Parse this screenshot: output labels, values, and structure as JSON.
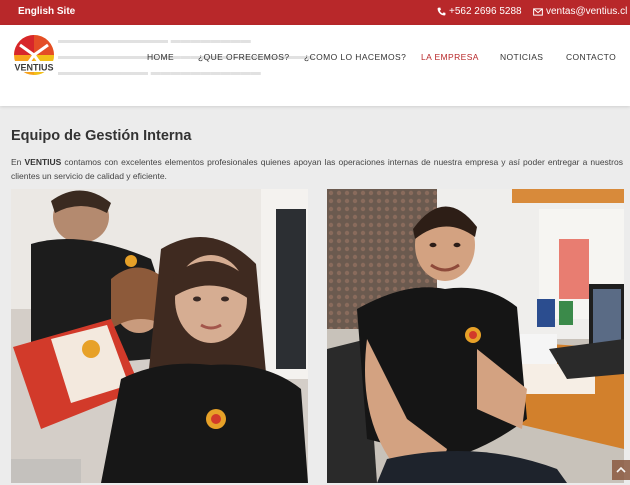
{
  "topbar": {
    "english_link": "English Site",
    "phone": "+562 2696 5288",
    "email": "ventas@ventius.cl",
    "background": "#b8282a"
  },
  "header": {
    "logo_text": "VENTIUS",
    "nav": [
      "HOME",
      "¿QUE OFRECEMOS?",
      "¿COMO LO HACEMOS?",
      "LA EMPRESA",
      "NOTICIAS",
      "CONTACTO"
    ],
    "active_nav": "LA EMPRESA",
    "accent": "#b8282a"
  },
  "main": {
    "title": "Equipo de Gestión Interna",
    "intro_brand": "VENTIUS",
    "intro_prefix": "En",
    "intro_text": "contamos con excelentes elementos profesionales quienes apoyan las operaciones internas de nuestra empresa y así poder entregar a nuestros clientes un servicio de calidad y eficiente."
  },
  "icons": {
    "phone": "phone-icon",
    "email": "envelope-icon",
    "scroll_top": "chevron-up-icon"
  }
}
